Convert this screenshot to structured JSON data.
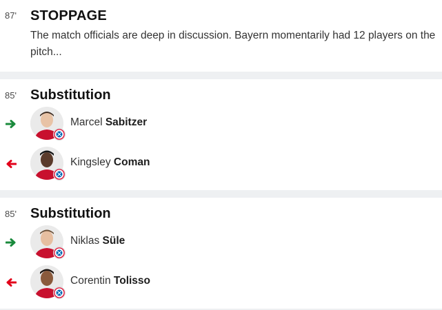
{
  "stoppage": {
    "minute": "87'",
    "title": "STOPPAGE",
    "text": "The match officials are deep in discussion. Bayern momentarily had 12 players on the pitch..."
  },
  "substitutions": [
    {
      "minute": "85'",
      "title": "Substitution",
      "player_in": {
        "first": "Marcel",
        "last": "Sabitzer"
      },
      "player_out": {
        "first": "Kingsley",
        "last": "Coman"
      }
    },
    {
      "minute": "85'",
      "title": "Substitution",
      "player_in": {
        "first": "Niklas",
        "last": "Süle"
      },
      "player_out": {
        "first": "Corentin",
        "last": "Tolisso"
      }
    }
  ],
  "colors": {
    "arrow_in": "#1a8a3c",
    "arrow_out": "#e2001a",
    "divider": "#eef0f2",
    "club_red": "#dc052d",
    "club_blue": "#0066b2"
  },
  "icons": {
    "arrow_in": "arrow-right-icon",
    "arrow_out": "arrow-left-icon",
    "club_badge": "club-badge-icon"
  }
}
